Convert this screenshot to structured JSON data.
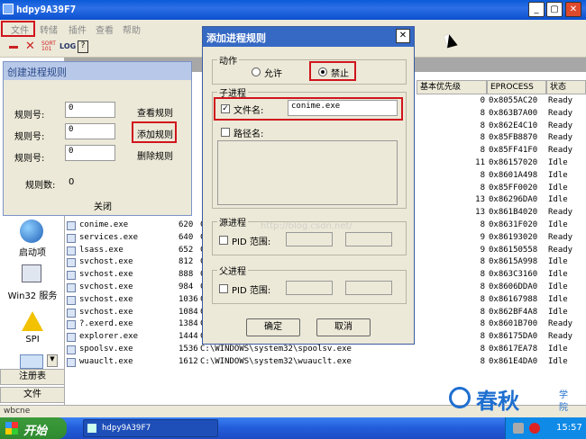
{
  "window": {
    "title": "hdpy9A39F7",
    "min": "_",
    "max": "▢",
    "close": "✕"
  },
  "menu": [
    "文件",
    "转储",
    "插件",
    "查看",
    "帮助"
  ],
  "toolbar": {
    "log": "LOG",
    "help": "?",
    "sorry": "SORT 101"
  },
  "columns": [
    "基本优先级",
    "EPROCESS",
    "状态"
  ],
  "processes": [
    {
      "name": "",
      "pid": "",
      "path": "",
      "prio": "0",
      "ep": "0x8055AC20",
      "st": "Ready"
    },
    {
      "name": "",
      "pid": "",
      "path": "",
      "prio": "8",
      "ep": "0x863B7A00",
      "st": "Ready"
    },
    {
      "name": "",
      "pid": "",
      "path": "",
      "prio": "8",
      "ep": "0x862E4C10",
      "st": "Ready"
    },
    {
      "name": "",
      "pid": "",
      "path": "",
      "prio": "8",
      "ep": "0x85FB8870",
      "st": "Ready"
    },
    {
      "name": "",
      "pid": "",
      "path": "",
      "prio": "8",
      "ep": "0x85FF41F0",
      "st": "Ready"
    },
    {
      "name": "",
      "pid": "",
      "path": "",
      "prio": "11",
      "ep": "0x86157020",
      "st": "Idle"
    },
    {
      "name": "",
      "pid": "",
      "path": "",
      "prio": "8",
      "ep": "0x8601A498",
      "st": "Idle"
    },
    {
      "name": "",
      "pid": "",
      "path": "",
      "prio": "8",
      "ep": "0x85FF0020",
      "st": "Idle"
    },
    {
      "name": "",
      "pid": "",
      "path": "",
      "prio": "13",
      "ep": "0x86296DA0",
      "st": "Idle"
    },
    {
      "name": "",
      "pid": "",
      "path": "",
      "prio": "13",
      "ep": "0x861B4020",
      "st": "Ready"
    },
    {
      "name": "conime.exe",
      "pid": "620",
      "path": "C",
      "prio": "8",
      "ep": "0x8631F020",
      "st": "Idle"
    },
    {
      "name": "services.exe",
      "pid": "640",
      "path": "C",
      "prio": "9",
      "ep": "0x86193020",
      "st": "Ready"
    },
    {
      "name": "lsass.exe",
      "pid": "652",
      "path": "C",
      "prio": "9",
      "ep": "0x86150558",
      "st": "Ready"
    },
    {
      "name": "svchost.exe",
      "pid": "812",
      "path": "C",
      "prio": "8",
      "ep": "0x8615A998",
      "st": "Idle"
    },
    {
      "name": "svchost.exe",
      "pid": "888",
      "path": "C",
      "prio": "8",
      "ep": "0x863C3160",
      "st": "Idle"
    },
    {
      "name": "svchost.exe",
      "pid": "984",
      "path": "C",
      "prio": "8",
      "ep": "0x8606DDA0",
      "st": "Idle"
    },
    {
      "name": "svchost.exe",
      "pid": "1036",
      "path": "C",
      "prio": "8",
      "ep": "0x86167988",
      "st": "Idle"
    },
    {
      "name": "svchost.exe",
      "pid": "1084",
      "path": "C",
      "prio": "8",
      "ep": "0x862BF4A8",
      "st": "Idle"
    },
    {
      "name": "?.exerd.exe",
      "pid": "1384",
      "path": "C",
      "prio": "8",
      "ep": "0x8601B700",
      "st": "Ready"
    },
    {
      "name": "explorer.exe",
      "pid": "1444",
      "path": "C",
      "prio": "8",
      "ep": "0x86175DA0",
      "st": "Ready"
    },
    {
      "name": "spoolsv.exe",
      "pid": "1536",
      "path": "C:\\WINDOWS\\system32\\spoolsv.exe",
      "prio": "8",
      "ep": "0x8617EA78",
      "st": "Idle"
    },
    {
      "name": "wuauclt.exe",
      "pid": "1612",
      "path": "C:\\WINDOWS\\system32\\wuauclt.exe",
      "prio": "8",
      "ep": "0x861E4DA0",
      "st": "Idle"
    }
  ],
  "sidebar": [
    {
      "label": "启动项",
      "icon": "globe-icon"
    },
    {
      "label": "Win32 服务",
      "icon": "computer-icon"
    },
    {
      "label": "SPI",
      "icon": "warning-icon"
    },
    {
      "label": "注册表",
      "icon": "registry-icon"
    },
    {
      "label": "文件",
      "icon": "file-icon"
    }
  ],
  "create_rule": {
    "title": "创建进程规则",
    "rule_no_label": "规则号:",
    "rows": [
      {
        "value": "0",
        "button": "查看规则"
      },
      {
        "value": "0",
        "button": "添加规则"
      },
      {
        "value": "0",
        "button": "删除规则"
      }
    ],
    "count_label": "规则数:",
    "count_value": "0",
    "close": "关闭"
  },
  "add_rule": {
    "title": "添加进程规则",
    "action_group": "动作",
    "allow": "允许",
    "deny": "禁止",
    "child_group": "子进程",
    "filename_label": "文件名:",
    "filename_value": "conime.exe",
    "path_label": "路径名:",
    "source_group": "源进程",
    "parent_group": "父进程",
    "pid_label": "PID 范围:",
    "ok": "确定",
    "cancel": "取消",
    "watermark": "http://blog.csdn.net/"
  },
  "status": "wbcne",
  "taskbar": {
    "start": "开始",
    "task": "hdpy9A39F7",
    "clock": "15:57"
  },
  "brand": {
    "name": "春秋",
    "sub1": "学",
    "sub2": "院"
  },
  "colors": {
    "highlight": "#d0151d",
    "titlebar": "#0a5bd8"
  }
}
